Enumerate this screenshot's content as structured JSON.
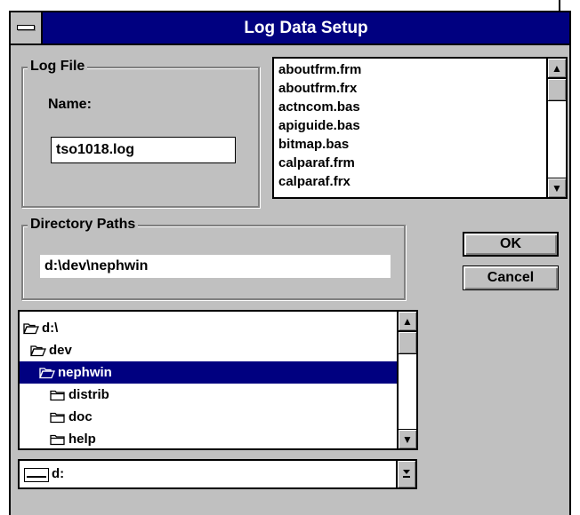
{
  "window": {
    "title": "Log Data Setup"
  },
  "log_file": {
    "group_label": "Log File",
    "name_label": "Name:",
    "name_value": "tso1018.log"
  },
  "file_list": {
    "items": [
      "aboutfrm.frm",
      "aboutfrm.frx",
      "actncom.bas",
      "apiguide.bas",
      "bitmap.bas",
      "calparaf.frm",
      "calparaf.frx"
    ]
  },
  "directory": {
    "group_label": "Directory Paths",
    "path_value": "d:\\dev\\nephwin"
  },
  "buttons": {
    "ok": "OK",
    "cancel": "Cancel"
  },
  "dir_tree": {
    "items": [
      {
        "label": "d:\\",
        "icon": "open-folder-icon",
        "selected": false
      },
      {
        "label": "dev",
        "icon": "open-folder-icon",
        "selected": false
      },
      {
        "label": "nephwin",
        "icon": "open-folder-icon",
        "selected": true
      },
      {
        "label": "distrib",
        "icon": "closed-folder-icon",
        "selected": false
      },
      {
        "label": "doc",
        "icon": "closed-folder-icon",
        "selected": false
      },
      {
        "label": "help",
        "icon": "closed-folder-icon",
        "selected": false
      }
    ]
  },
  "drive": {
    "value": "d:",
    "icon": "drive-icon"
  },
  "colors": {
    "titlebar": "#000080",
    "face": "#c0c0c0",
    "selection": "#000080"
  }
}
